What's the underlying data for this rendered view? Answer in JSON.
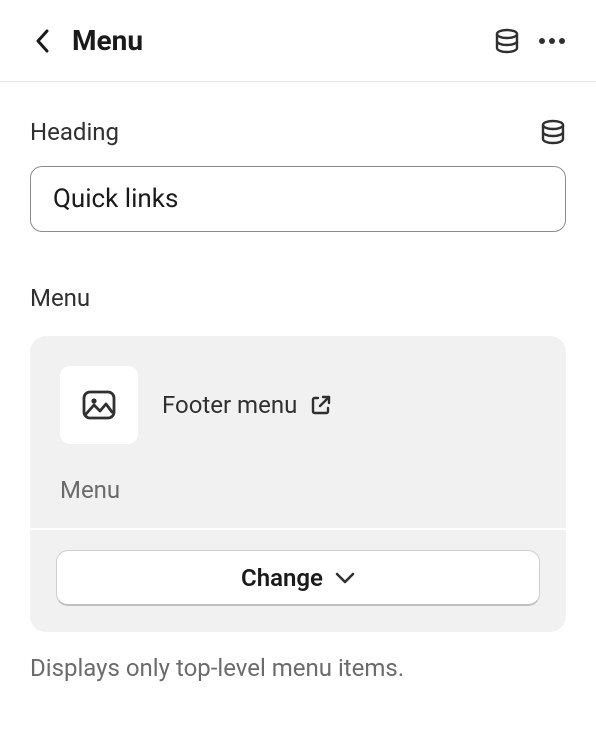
{
  "header": {
    "title": "Menu"
  },
  "heading": {
    "label": "Heading",
    "value": "Quick links"
  },
  "menu": {
    "label": "Menu",
    "selected_name": "Footer menu",
    "sublabel": "Menu",
    "change_label": "Change",
    "helper_text": "Displays only top-level menu items."
  }
}
